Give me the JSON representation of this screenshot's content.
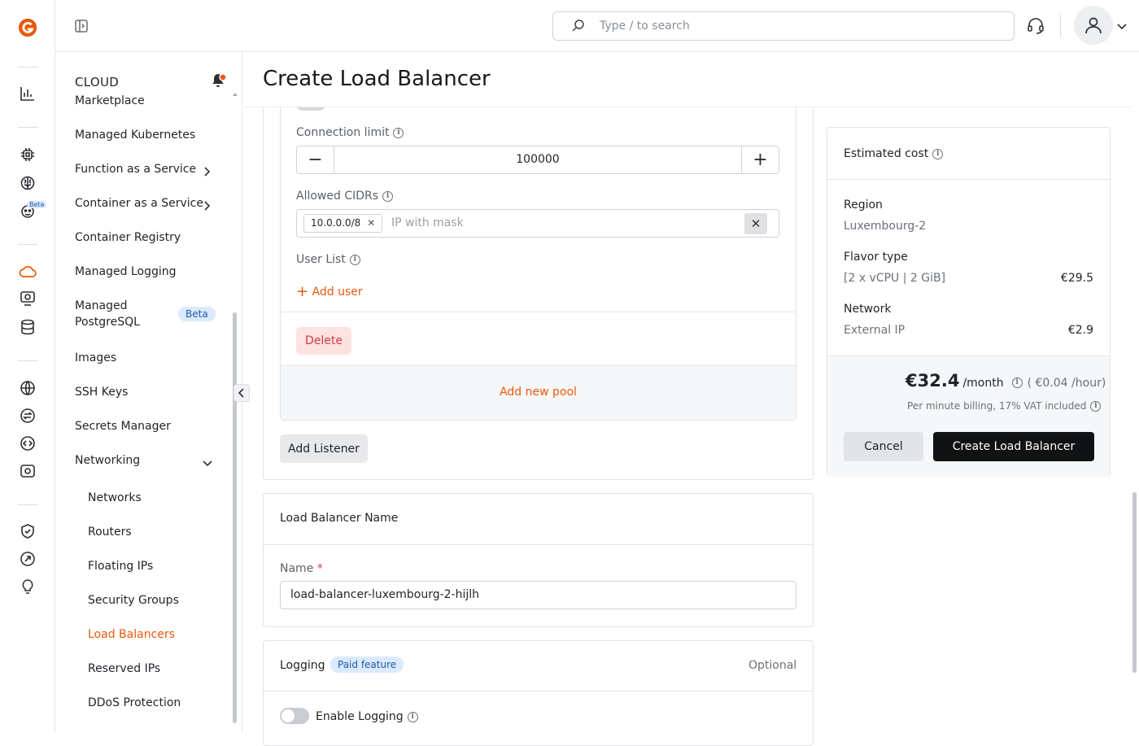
{
  "search": {
    "placeholder": "Type / to search"
  },
  "rail": {
    "beta_badge": "Beta"
  },
  "sidebar": {
    "section": "CLOUD",
    "items": [
      {
        "label": "Marketplace"
      },
      {
        "label": "Managed Kubernetes"
      },
      {
        "label": "Function as a Service"
      },
      {
        "label": "Container as a Service"
      },
      {
        "label": "Container Registry"
      },
      {
        "label": "Managed Logging"
      },
      {
        "label": "Managed PostgreSQL",
        "line1": "Managed",
        "line2": "PostgreSQL",
        "badge": "Beta"
      },
      {
        "label": "Images"
      },
      {
        "label": "SSH Keys"
      },
      {
        "label": "Secrets Manager"
      },
      {
        "label": "Networking"
      }
    ],
    "networking_items": [
      {
        "label": "Networks"
      },
      {
        "label": "Routers"
      },
      {
        "label": "Floating IPs"
      },
      {
        "label": "Security Groups"
      },
      {
        "label": "Load Balancers",
        "active": true
      },
      {
        "label": "Reserved IPs"
      },
      {
        "label": "DDoS Protection"
      }
    ]
  },
  "page": {
    "title": "Create Load Balancer"
  },
  "pool": {
    "connection_limit_label": "Connection limit",
    "connection_limit_value": "100000",
    "allowed_cidrs_label": "Allowed CIDRs",
    "cidr_chip": "10.0.0.0/8",
    "cidr_placeholder": "IP with mask",
    "user_list_label": "User List",
    "add_user": "Add user",
    "delete": "Delete",
    "add_new_pool": "Add new pool"
  },
  "listener": {
    "add_listener": "Add Listener"
  },
  "name_section": {
    "title": "Load Balancer Name",
    "name_label": "Name",
    "required_mark": "*",
    "name_value": "load-balancer-luxembourg-2-hijlh"
  },
  "logging": {
    "title": "Logging",
    "badge": "Paid feature",
    "optional": "Optional",
    "enable_label": "Enable Logging",
    "enabled": false
  },
  "cost": {
    "title": "Estimated cost",
    "region_label": "Region",
    "region_value": "Luxembourg-2",
    "flavor_label": "Flavor type",
    "flavor_value": "[2 x vCPU | 2 GiB]",
    "flavor_price": "€29.5",
    "network_label": "Network",
    "network_value": "External IP",
    "network_price": "€2.9",
    "total": "€32.4",
    "per_month": "/month",
    "per_hour": "( €0.04 /hour)",
    "billing_note": "Per minute billing, 17% VAT included",
    "cancel": "Cancel",
    "create": "Create Load Balancer"
  },
  "colors": {
    "accent": "#e8590c",
    "primary_button": "#101214",
    "badge_bg": "#dbeafe"
  }
}
